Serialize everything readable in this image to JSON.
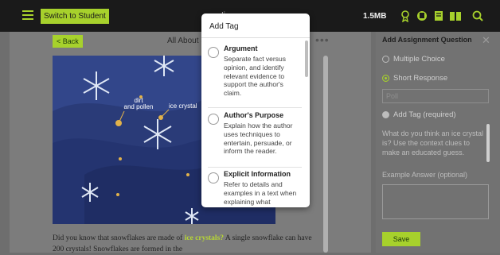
{
  "topbar": {
    "switch_label": "Switch to Student",
    "mid_text": "Ii",
    "storage_label": "1.5MB",
    "icons": [
      "menu-icon",
      "bookmark-add-icon",
      "highlighter-icon",
      "bookmark-icon",
      "book-icon",
      "search-icon"
    ]
  },
  "reader": {
    "back_label": "< Back",
    "title": "All About S",
    "more_label": "•••",
    "illustration_labels": {
      "dirt": "dirt\nand pollen",
      "ice": "ice crystal"
    },
    "text_before": "Did you know that snowflakes are made of ",
    "text_highlight": "ice crystals?",
    "text_after": " A single snowflake can have 200 crystals! Snowflakes are formed in the"
  },
  "panel": {
    "title": "Add Assignment Question",
    "close": "✕",
    "options": [
      {
        "label": "Multiple Choice",
        "selected": false
      },
      {
        "label": "Short Response",
        "selected": true
      }
    ],
    "text_field_placeholder": "Poll",
    "add_tag_label": "Add Tag (required)",
    "question": "What do you think an ice crystal is?  Use the context clues to make an educated guess.",
    "answer_label": "Example Answer (optional)",
    "save_label": "Save"
  },
  "popup": {
    "title": "Add Tag",
    "tags": [
      {
        "name": "Argument",
        "desc": "Separate fact versus opinion, and identify relevant evidence to support the author's claim."
      },
      {
        "name": "Author's Purpose",
        "desc": "Explain how the author uses techniques to entertain, persuade, or inform the reader."
      },
      {
        "name": "Explicit Information",
        "desc": "Refer to details and examples in a text when explaining what"
      }
    ]
  },
  "colors": {
    "accent": "#a7d12c",
    "topbar": "#1a1a1a",
    "illustration_sky": "#32468a"
  }
}
